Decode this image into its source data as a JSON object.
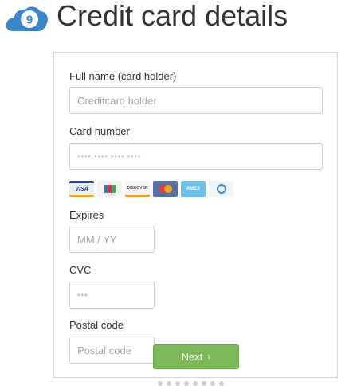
{
  "header": {
    "step_number": "9",
    "title": "Credit card details"
  },
  "form": {
    "full_name": {
      "label": "Full name (card holder)",
      "placeholder": "Creditcard holder"
    },
    "card_number": {
      "label": "Card number",
      "placeholder": "**** **** **** ****"
    },
    "expires": {
      "label": "Expires",
      "placeholder": "MM / YY"
    },
    "cvc": {
      "label": "CVC",
      "placeholder": "***"
    },
    "postal_code": {
      "label": "Postal code",
      "placeholder": "Postal code"
    },
    "brands": {
      "visa": "VISA",
      "discover": "DISCOVER",
      "amex": "AMEX"
    },
    "next_button": {
      "label": "Next",
      "icon": "chevron-right-icon"
    }
  },
  "colors": {
    "accent_blue": "#3a86c8",
    "next_green": "#7db95a"
  }
}
